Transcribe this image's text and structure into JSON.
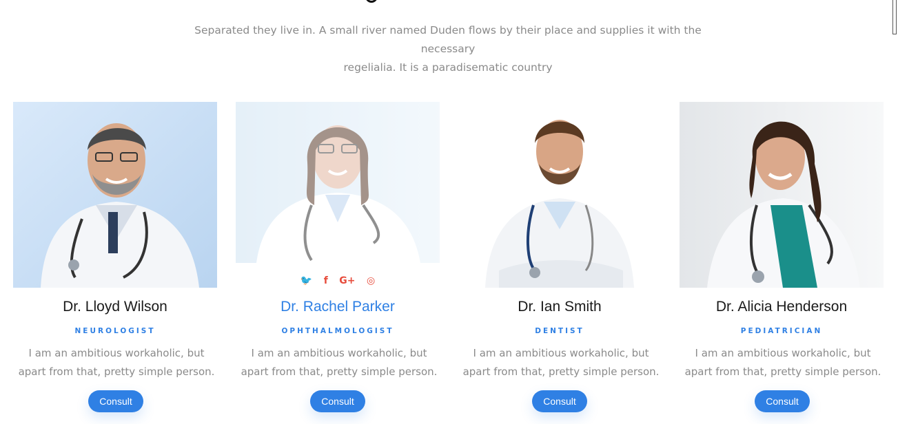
{
  "intro": {
    "line1": "Separated they live in. A small river named Duden flows by their place and supplies it with the necessary",
    "line2": "regelialia. It is a paradisematic country"
  },
  "doctors": [
    {
      "name": "Dr. Lloyd Wilson",
      "specialty": "NEUROLOGIST",
      "desc1": "I am an ambitious workaholic, but",
      "desc2": "apart from that, pretty simple person.",
      "button": "Consult"
    },
    {
      "name": "Dr. Rachel Parker",
      "specialty": "OPHTHALMOLOGIST",
      "desc1": "I am an ambitious workaholic, but",
      "desc2": "apart from that, pretty simple person.",
      "button": "Consult",
      "social": {
        "twitter": "🐦",
        "facebook": "f",
        "google": "G+",
        "instagram": "◎"
      }
    },
    {
      "name": "Dr. Ian Smith",
      "specialty": "DENTIST",
      "desc1": "I am an ambitious workaholic, but",
      "desc2": "apart from that, pretty simple person.",
      "button": "Consult"
    },
    {
      "name": "Dr. Alicia Henderson",
      "specialty": "PEDIATRICIAN",
      "desc1": "I am an ambitious workaholic, but",
      "desc2": "apart from that, pretty simple person.",
      "button": "Consult"
    }
  ],
  "colors": {
    "accent": "#2f80e4",
    "social": "#e74c3c",
    "text_muted": "#8a8a8a"
  }
}
